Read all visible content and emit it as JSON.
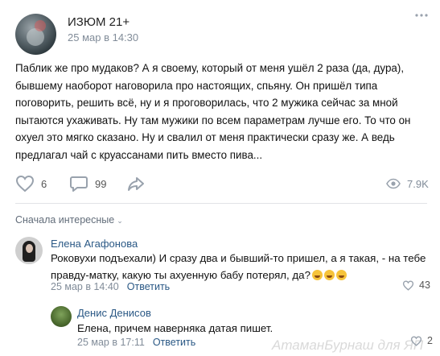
{
  "post": {
    "author": "ИЗЮМ 21+",
    "date": "25 мар в 14:30",
    "more_icon": "more-dots-icon",
    "text": "Паблик же про мудаков? А я своему, который от меня ушёл 2 раза (да, дура), бывшему наоборот наговорила про настоящих, спьяну. Он пришёл типа поговорить, решить всё, ну и я проговорилась, что 2 мужика сейчас за мной пытаются ухаживать. Ну там мужики по всем параметрам лучше его. То что он охуел это мягко сказано. Ну и свалил от меня практически сразу же. А ведь предлагал чай с круассанами пить вместо пива..."
  },
  "actions": {
    "likes": "6",
    "comments": "99",
    "views": "7.9K"
  },
  "comments_sort": "Сначала интересные",
  "comments": [
    {
      "name": "Елена Агафонова",
      "text": "Роковухи подъехали) И сразу два и бывший-то пришел, а я такая, - на тебе правду-матку, какую ты ахуенную бабу потерял, да?",
      "date": "25 мар в 14:40",
      "reply": "Ответить",
      "likes": "43"
    },
    {
      "name": "Денис Денисов",
      "text": "Елена, причем наверняка датая пишет.",
      "date": "25 мар в 17:11",
      "reply": "Ответить",
      "likes": "2"
    }
  ],
  "watermark": "АтаманБурнаш для ЯП",
  "colors": {
    "link": "#2a5885",
    "muted": "#818c99",
    "divider": "#e1e3e6"
  }
}
